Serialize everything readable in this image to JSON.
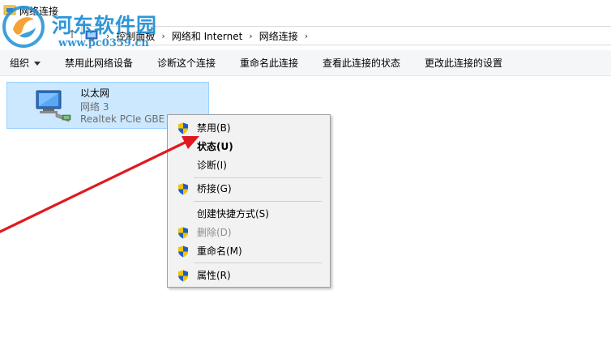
{
  "window": {
    "title": "网络连接"
  },
  "breadcrumb": {
    "items": [
      "控制面板",
      "网络和 Internet",
      "网络连接"
    ]
  },
  "toolbar": {
    "organize": "组织",
    "disable": "禁用此网络设备",
    "diagnose": "诊断这个连接",
    "rename": "重命名此连接",
    "status": "查看此连接的状态",
    "settings": "更改此连接的设置"
  },
  "adapter": {
    "name": "以太网",
    "network": "网络 3",
    "device": "Realtek PCIe GBE F"
  },
  "context_menu": {
    "items": [
      {
        "label": "禁用(B)",
        "shield": true,
        "bold": false,
        "disabled": false
      },
      {
        "label": "状态(U)",
        "shield": false,
        "bold": true,
        "disabled": false
      },
      {
        "label": "诊断(I)",
        "shield": false,
        "bold": false,
        "disabled": false
      },
      {
        "label": "桥接(G)",
        "shield": true,
        "bold": false,
        "disabled": false
      },
      {
        "label": "创建快捷方式(S)",
        "shield": false,
        "bold": false,
        "disabled": false
      },
      {
        "label": "删除(D)",
        "shield": true,
        "bold": false,
        "disabled": true
      },
      {
        "label": "重命名(M)",
        "shield": true,
        "bold": false,
        "disabled": false
      },
      {
        "label": "属性(R)",
        "shield": true,
        "bold": false,
        "disabled": false
      }
    ]
  },
  "watermark": {
    "title": "河东软件园",
    "url": "www.pc0359.cn"
  },
  "colors": {
    "selection": "#cce8ff",
    "selection_border": "#99d1ff",
    "arrow": "#e0191f",
    "watermark": "#1e8fd5"
  }
}
